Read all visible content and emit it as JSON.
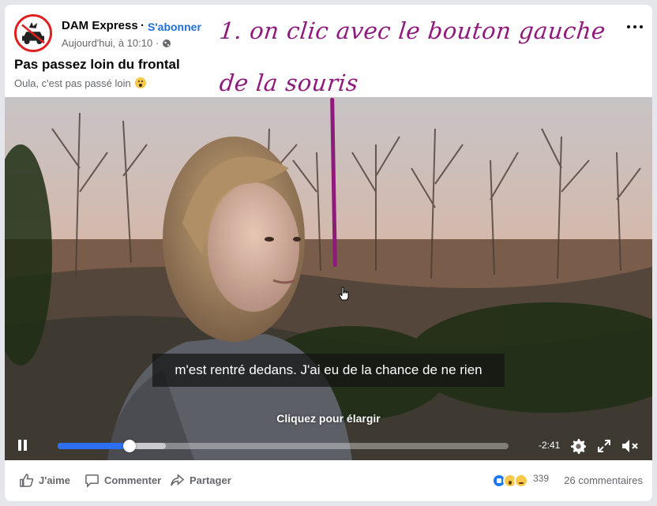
{
  "post": {
    "page_name": "DAM Express",
    "separator": "·",
    "subscribe_label": "S'abonner",
    "timestamp": "Aujourd'hui, à 10:10 ·",
    "title": "Pas passez loin du frontal",
    "subtitle": "Oula, c'est pas passé loin"
  },
  "annotation": {
    "line1": "1. on clic avec le bouton gauche",
    "line2": "de la souris",
    "color": "#8e1a7c"
  },
  "video": {
    "caption": "m'est rentré dedans. J'ai eu de la chance de ne rien",
    "expand_hint": "Cliquez pour élargir",
    "time_remaining": "-2:41",
    "progress_played": 0.16,
    "progress_buffered": 0.24,
    "accent_color": "#2d6ff2"
  },
  "actions": {
    "like": "J'aime",
    "comment": "Commenter",
    "share": "Partager",
    "reaction_count": "339",
    "comments_count": "26 commentaires"
  },
  "icons": [
    "globe-icon",
    "more-icon",
    "pause-icon",
    "gear-icon",
    "fullscreen-icon",
    "mute-icon",
    "like-icon",
    "comment-icon",
    "share-icon",
    "hand-cursor-icon"
  ]
}
